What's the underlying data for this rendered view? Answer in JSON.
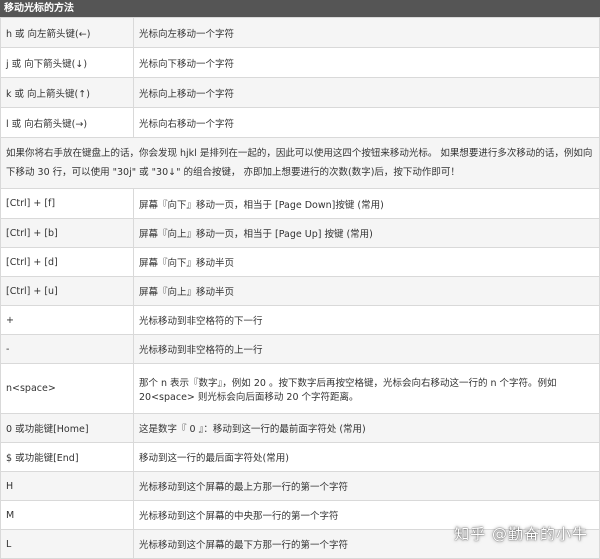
{
  "title": "移动光标的方法",
  "table1": [
    {
      "key": "h 或 向左箭头键(←)",
      "desc": "光标向左移动一个字符"
    },
    {
      "key": "j 或 向下箭头键(↓)",
      "desc": "光标向下移动一个字符"
    },
    {
      "key": "k 或 向上箭头键(↑)",
      "desc": "光标向上移动一个字符"
    },
    {
      "key": "l 或 向右箭头键(→)",
      "desc": "光标向右移动一个字符"
    }
  ],
  "note": "如果你将右手放在键盘上的话，你会发现 hjkl 是排列在一起的，因此可以使用这四个按钮来移动光标。 如果想要进行多次移动的话，例如向下移动 30 行，可以使用 \"30j\" 或 \"30↓\" 的组合按键， 亦即加上想要进行的次数(数字)后，按下动作即可！",
  "table2": [
    {
      "key": "[Ctrl] + [f]",
      "desc": "屏幕『向下』移动一页，相当于 [Page Down]按键 (常用)"
    },
    {
      "key": "[Ctrl] + [b]",
      "desc": "屏幕『向上』移动一页，相当于 [Page Up] 按键 (常用)"
    },
    {
      "key": "[Ctrl] + [d]",
      "desc": "屏幕『向下』移动半页"
    },
    {
      "key": "[Ctrl] + [u]",
      "desc": "屏幕『向上』移动半页"
    },
    {
      "key": "+",
      "desc": "光标移动到非空格符的下一行"
    },
    {
      "key": "-",
      "desc": "光标移动到非空格符的上一行"
    },
    {
      "key": "n<space>",
      "desc": "那个 n 表示『数字』，例如 20 。按下数字后再按空格键，光标会向右移动这一行的 n 个字符。例如 20<space> 则光标会向后面移动 20 个字符距离。"
    },
    {
      "key": "0 或功能键[Home]",
      "desc": "这是数字『 0 』：移动到这一行的最前面字符处 (常用)"
    },
    {
      "key": "$ 或功能键[End]",
      "desc": "移动到这一行的最后面字符处(常用)"
    },
    {
      "key": "H",
      "desc": "光标移动到这个屏幕的最上方那一行的第一个字符"
    },
    {
      "key": "M",
      "desc": "光标移动到这个屏幕的中央那一行的第一个字符"
    },
    {
      "key": "L",
      "desc": "光标移动到这个屏幕的最下方那一行的第一个字符"
    }
  ],
  "watermark": "知乎 @勤奋的小牛"
}
